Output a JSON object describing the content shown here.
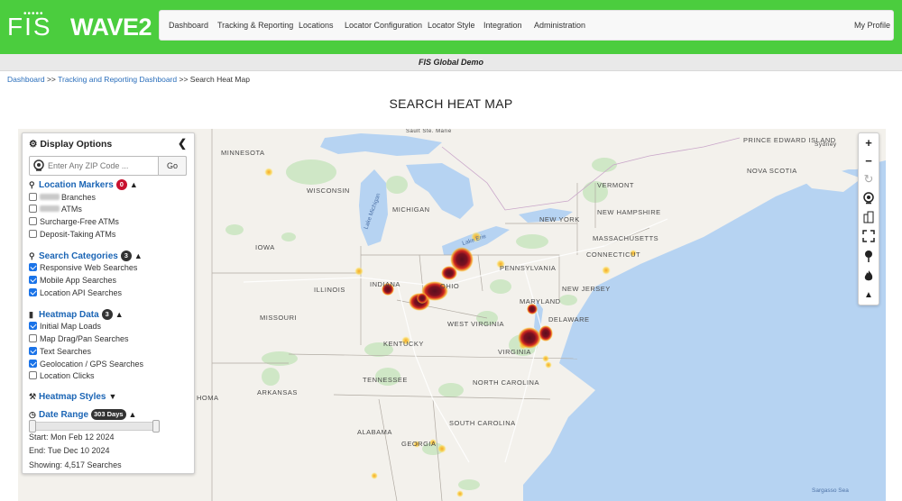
{
  "brand": {
    "logo_fis": "FIS",
    "logo_wave": "WAVE2"
  },
  "nav": {
    "items": [
      "Dashboard",
      "Tracking & Reporting",
      "Locations",
      "Locator Configuration",
      "Locator Style",
      "Integration",
      "Administration"
    ],
    "profile": "My Profile"
  },
  "subheader": "FIS Global Demo",
  "breadcrumb": {
    "link1": "Dashboard",
    "sep1": ">>",
    "link2": "Tracking and Reporting Dashboard",
    "sep2": ">>",
    "current": "Search Heat Map"
  },
  "page_title": "SEARCH HEAT MAP",
  "panel": {
    "title": "Display Options",
    "zip_placeholder": "Enter Any ZIP Code ...",
    "go_label": "Go",
    "location_markers": {
      "title": "Location Markers",
      "count": "0",
      "items": [
        {
          "label": "Branches",
          "checked": false
        },
        {
          "label": "ATMs",
          "checked": false
        },
        {
          "label": "Surcharge-Free ATMs",
          "checked": false
        },
        {
          "label": "Deposit-Taking ATMs",
          "checked": false
        }
      ]
    },
    "search_categories": {
      "title": "Search Categories",
      "count": "3",
      "items": [
        {
          "label": "Responsive Web Searches",
          "checked": true
        },
        {
          "label": "Mobile App Searches",
          "checked": true
        },
        {
          "label": "Location API Searches",
          "checked": true
        }
      ]
    },
    "heatmap_data": {
      "title": "Heatmap Data",
      "count": "3",
      "items": [
        {
          "label": "Initial Map Loads",
          "checked": true
        },
        {
          "label": "Map Drag/Pan Searches",
          "checked": false
        },
        {
          "label": "Text Searches",
          "checked": true
        },
        {
          "label": "Geolocation / GPS Searches",
          "checked": true
        },
        {
          "label": "Location Clicks",
          "checked": false
        }
      ]
    },
    "heatmap_styles": {
      "title": "Heatmap Styles"
    },
    "date_range": {
      "title": "Date Range",
      "days": "303 Days",
      "start": "Start: Mon Feb 12 2024",
      "end": "End: Tue Dec 10 2024",
      "showing": "Showing: 4,517 Searches"
    }
  },
  "map": {
    "labels": {
      "minnesota": "MINNESOTA",
      "wisconsin": "WISCONSIN",
      "michigan": "MICHIGAN",
      "iowa": "IOWA",
      "illinois": "ILLINOIS",
      "indiana": "INDIANA",
      "ohio": "OHIO",
      "missouri": "MISSOURI",
      "kentucky": "KENTUCKY",
      "west_virginia": "WEST VIRGINIA",
      "virginia": "VIRGINIA",
      "pennsylvania": "PENNSYLVANIA",
      "new_york": "NEW YORK",
      "vermont": "VERMONT",
      "new_hampshire": "NEW HAMPSHIRE",
      "massachusetts": "MASSACHUSETTS",
      "connecticut": "CONNECTICUT",
      "new_jersey": "NEW JERSEY",
      "maryland": "MARYLAND",
      "delaware": "DELAWARE",
      "tennessee": "TENNESSEE",
      "north_carolina": "NORTH CAROLINA",
      "south_carolina": "SOUTH CAROLINA",
      "arkansas": "ARKANSAS",
      "alabama": "ALABAMA",
      "georgia": "GEORGIA",
      "oklahoma": "HOMA",
      "prince_edward_island": "PRINCE EDWARD ISLAND",
      "nova_scotia": "NOVA SCOTIA",
      "sydney": "Sydney",
      "lake_michigan": "Lake Michigan",
      "lake_erie": "Lake Erie",
      "sault": "Sault Ste. Marie",
      "sargasso": "Sargasso Sea"
    }
  },
  "controls": [
    "zoom-in",
    "zoom-out",
    "refresh",
    "locate",
    "buildings",
    "fullscreen",
    "pin",
    "fire",
    "pan"
  ]
}
